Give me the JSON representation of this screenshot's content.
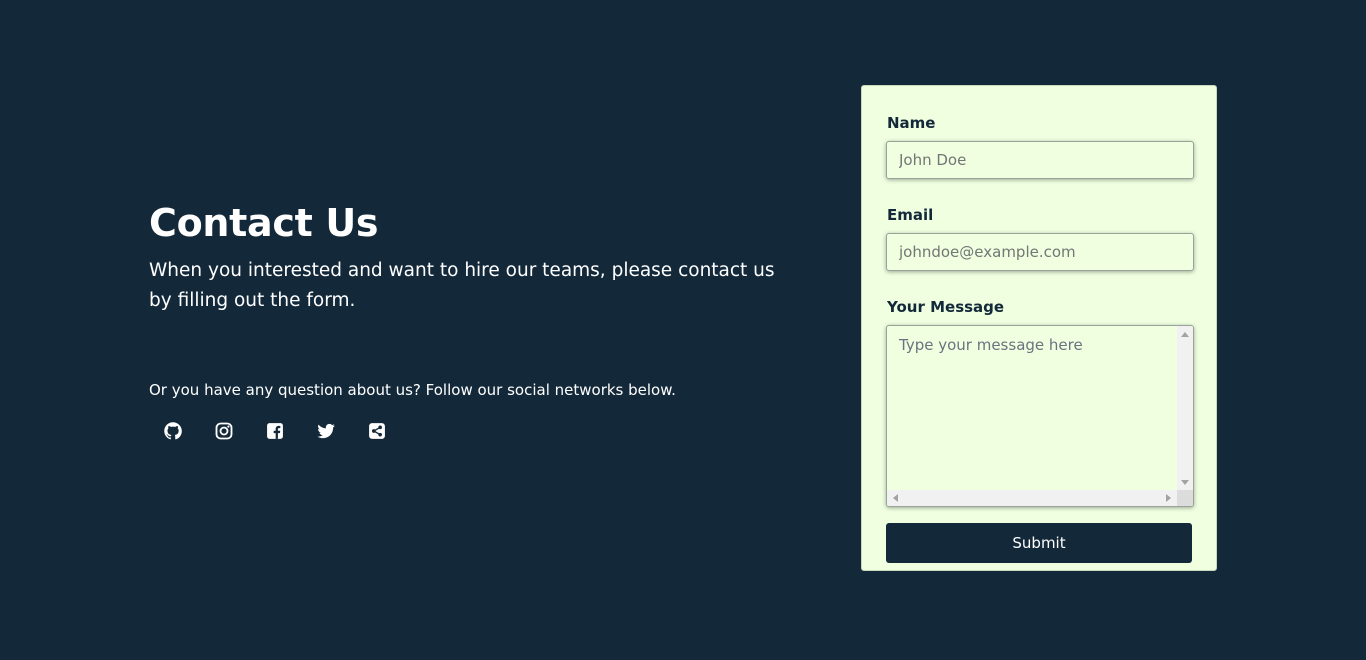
{
  "intro": {
    "title": "Contact Us",
    "lead": "When you interested and want to hire our teams, please contact us by filling out the form.",
    "follow_text": "Or you have any question about us? Follow our social networks below."
  },
  "socials": [
    {
      "icon": "github-icon"
    },
    {
      "icon": "instagram-icon"
    },
    {
      "icon": "facebook-icon"
    },
    {
      "icon": "twitter-icon"
    },
    {
      "icon": "share-icon"
    }
  ],
  "form": {
    "name_label": "Name",
    "name_placeholder": "John Doe",
    "email_label": "Email",
    "email_placeholder": "johndoe@example.com",
    "message_label": "Your Message",
    "message_placeholder": "Type your message here",
    "submit_label": "Submit"
  },
  "colors": {
    "background": "#13293a",
    "card": "#efffe0",
    "button": "#13293a",
    "text_light": "#ffffff"
  }
}
